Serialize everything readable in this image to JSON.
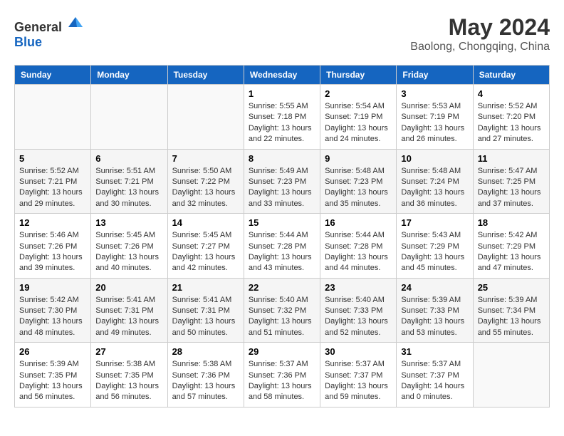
{
  "header": {
    "logo_general": "General",
    "logo_blue": "Blue",
    "month_year": "May 2024",
    "location": "Baolong, Chongqing, China"
  },
  "days_of_week": [
    "Sunday",
    "Monday",
    "Tuesday",
    "Wednesday",
    "Thursday",
    "Friday",
    "Saturday"
  ],
  "weeks": [
    [
      {
        "day": "",
        "info": ""
      },
      {
        "day": "",
        "info": ""
      },
      {
        "day": "",
        "info": ""
      },
      {
        "day": "1",
        "info": "Sunrise: 5:55 AM\nSunset: 7:18 PM\nDaylight: 13 hours\nand 22 minutes."
      },
      {
        "day": "2",
        "info": "Sunrise: 5:54 AM\nSunset: 7:19 PM\nDaylight: 13 hours\nand 24 minutes."
      },
      {
        "day": "3",
        "info": "Sunrise: 5:53 AM\nSunset: 7:19 PM\nDaylight: 13 hours\nand 26 minutes."
      },
      {
        "day": "4",
        "info": "Sunrise: 5:52 AM\nSunset: 7:20 PM\nDaylight: 13 hours\nand 27 minutes."
      }
    ],
    [
      {
        "day": "5",
        "info": "Sunrise: 5:52 AM\nSunset: 7:21 PM\nDaylight: 13 hours\nand 29 minutes."
      },
      {
        "day": "6",
        "info": "Sunrise: 5:51 AM\nSunset: 7:21 PM\nDaylight: 13 hours\nand 30 minutes."
      },
      {
        "day": "7",
        "info": "Sunrise: 5:50 AM\nSunset: 7:22 PM\nDaylight: 13 hours\nand 32 minutes."
      },
      {
        "day": "8",
        "info": "Sunrise: 5:49 AM\nSunset: 7:23 PM\nDaylight: 13 hours\nand 33 minutes."
      },
      {
        "day": "9",
        "info": "Sunrise: 5:48 AM\nSunset: 7:23 PM\nDaylight: 13 hours\nand 35 minutes."
      },
      {
        "day": "10",
        "info": "Sunrise: 5:48 AM\nSunset: 7:24 PM\nDaylight: 13 hours\nand 36 minutes."
      },
      {
        "day": "11",
        "info": "Sunrise: 5:47 AM\nSunset: 7:25 PM\nDaylight: 13 hours\nand 37 minutes."
      }
    ],
    [
      {
        "day": "12",
        "info": "Sunrise: 5:46 AM\nSunset: 7:26 PM\nDaylight: 13 hours\nand 39 minutes."
      },
      {
        "day": "13",
        "info": "Sunrise: 5:45 AM\nSunset: 7:26 PM\nDaylight: 13 hours\nand 40 minutes."
      },
      {
        "day": "14",
        "info": "Sunrise: 5:45 AM\nSunset: 7:27 PM\nDaylight: 13 hours\nand 42 minutes."
      },
      {
        "day": "15",
        "info": "Sunrise: 5:44 AM\nSunset: 7:28 PM\nDaylight: 13 hours\nand 43 minutes."
      },
      {
        "day": "16",
        "info": "Sunrise: 5:44 AM\nSunset: 7:28 PM\nDaylight: 13 hours\nand 44 minutes."
      },
      {
        "day": "17",
        "info": "Sunrise: 5:43 AM\nSunset: 7:29 PM\nDaylight: 13 hours\nand 45 minutes."
      },
      {
        "day": "18",
        "info": "Sunrise: 5:42 AM\nSunset: 7:29 PM\nDaylight: 13 hours\nand 47 minutes."
      }
    ],
    [
      {
        "day": "19",
        "info": "Sunrise: 5:42 AM\nSunset: 7:30 PM\nDaylight: 13 hours\nand 48 minutes."
      },
      {
        "day": "20",
        "info": "Sunrise: 5:41 AM\nSunset: 7:31 PM\nDaylight: 13 hours\nand 49 minutes."
      },
      {
        "day": "21",
        "info": "Sunrise: 5:41 AM\nSunset: 7:31 PM\nDaylight: 13 hours\nand 50 minutes."
      },
      {
        "day": "22",
        "info": "Sunrise: 5:40 AM\nSunset: 7:32 PM\nDaylight: 13 hours\nand 51 minutes."
      },
      {
        "day": "23",
        "info": "Sunrise: 5:40 AM\nSunset: 7:33 PM\nDaylight: 13 hours\nand 52 minutes."
      },
      {
        "day": "24",
        "info": "Sunrise: 5:39 AM\nSunset: 7:33 PM\nDaylight: 13 hours\nand 53 minutes."
      },
      {
        "day": "25",
        "info": "Sunrise: 5:39 AM\nSunset: 7:34 PM\nDaylight: 13 hours\nand 55 minutes."
      }
    ],
    [
      {
        "day": "26",
        "info": "Sunrise: 5:39 AM\nSunset: 7:35 PM\nDaylight: 13 hours\nand 56 minutes."
      },
      {
        "day": "27",
        "info": "Sunrise: 5:38 AM\nSunset: 7:35 PM\nDaylight: 13 hours\nand 56 minutes."
      },
      {
        "day": "28",
        "info": "Sunrise: 5:38 AM\nSunset: 7:36 PM\nDaylight: 13 hours\nand 57 minutes."
      },
      {
        "day": "29",
        "info": "Sunrise: 5:37 AM\nSunset: 7:36 PM\nDaylight: 13 hours\nand 58 minutes."
      },
      {
        "day": "30",
        "info": "Sunrise: 5:37 AM\nSunset: 7:37 PM\nDaylight: 13 hours\nand 59 minutes."
      },
      {
        "day": "31",
        "info": "Sunrise: 5:37 AM\nSunset: 7:37 PM\nDaylight: 14 hours\nand 0 minutes."
      },
      {
        "day": "",
        "info": ""
      }
    ]
  ]
}
